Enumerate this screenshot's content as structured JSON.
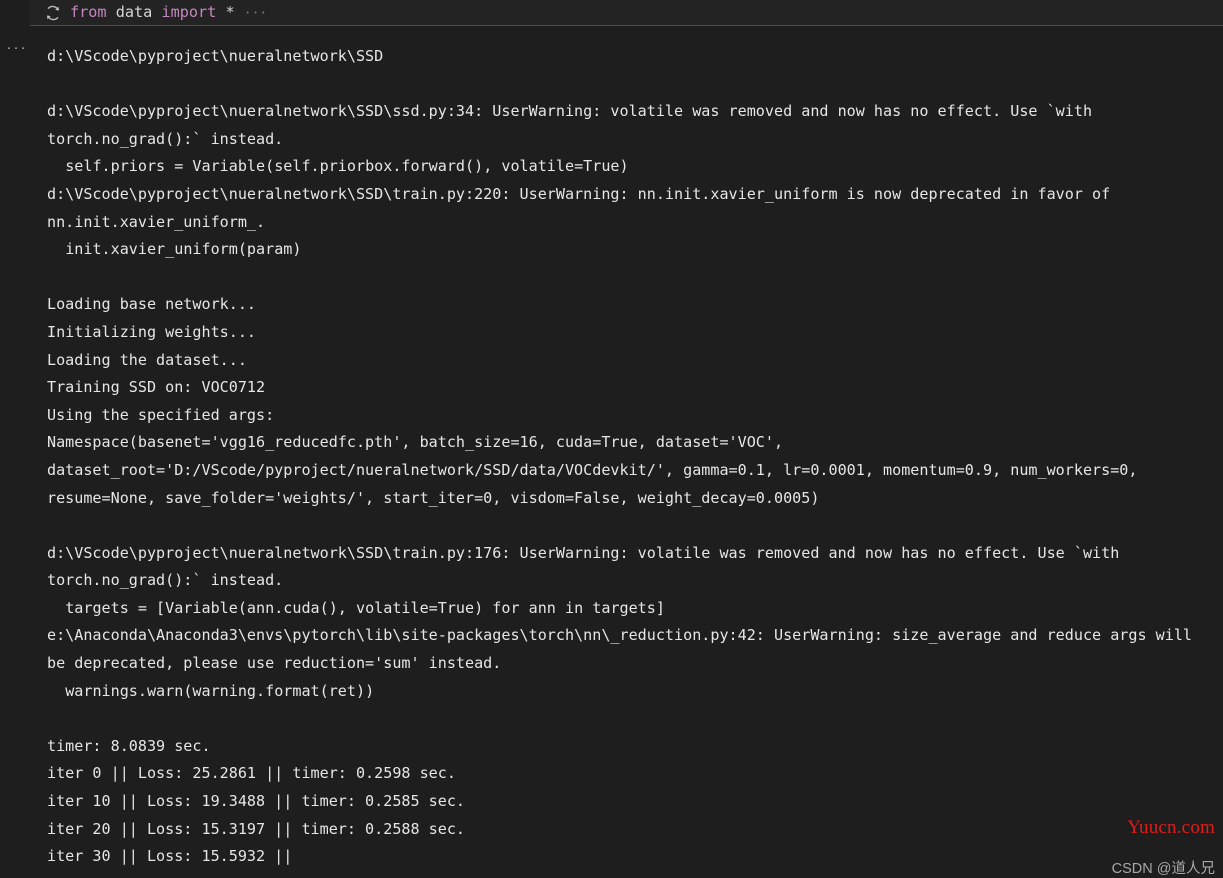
{
  "cell": {
    "run_icon": "restart-run-icon",
    "code": {
      "kw1": "from",
      "mod": " data ",
      "kw2": "import",
      "star": " *",
      "ellipsis": "···"
    }
  },
  "gutter": {
    "more_actions": "···"
  },
  "output": {
    "lines": [
      "d:\\VScode\\pyproject\\nueralnetwork\\SSD",
      "",
      "d:\\VScode\\pyproject\\nueralnetwork\\SSD\\ssd.py:34: UserWarning: volatile was removed and now has no effect. Use `with torch.no_grad():` instead.",
      "  self.priors = Variable(self.priorbox.forward(), volatile=True)",
      "d:\\VScode\\pyproject\\nueralnetwork\\SSD\\train.py:220: UserWarning: nn.init.xavier_uniform is now deprecated in favor of nn.init.xavier_uniform_.",
      "  init.xavier_uniform(param)",
      "",
      "Loading base network...",
      "Initializing weights...",
      "Loading the dataset...",
      "Training SSD on: VOC0712",
      "Using the specified args:",
      "Namespace(basenet='vgg16_reducedfc.pth', batch_size=16, cuda=True, dataset='VOC',",
      "dataset_root='D:/VScode/pyproject/nueralnetwork/SSD/data/VOCdevkit/', gamma=0.1, lr=0.0001, momentum=0.9, num_workers=0,",
      "resume=None, save_folder='weights/', start_iter=0, visdom=False, weight_decay=0.0005)",
      "",
      "d:\\VScode\\pyproject\\nueralnetwork\\SSD\\train.py:176: UserWarning: volatile was removed and now has no effect. Use `with torch.no_grad():` instead.",
      "  targets = [Variable(ann.cuda(), volatile=True) for ann in targets]",
      "e:\\Anaconda\\Anaconda3\\envs\\pytorch\\lib\\site-packages\\torch\\nn\\_reduction.py:42: UserWarning: size_average and reduce args will be deprecated, please use reduction='sum' instead.",
      "  warnings.warn(warning.format(ret))",
      "",
      "timer: 8.0839 sec.",
      "iter 0 || Loss: 25.2861 || timer: 0.2598 sec.",
      "iter 10 || Loss: 19.3488 || timer: 0.2585 sec.",
      "iter 20 || Loss: 15.3197 || timer: 0.2588 sec.",
      "iter 30 || Loss: 15.5932 ||"
    ],
    "training_log": [
      {
        "iter": "0",
        "loss": "25.2861",
        "timer": "0.2598"
      },
      {
        "iter": "10",
        "loss": "19.3488",
        "timer": "0.2585"
      },
      {
        "iter": "20",
        "loss": "15.3197",
        "timer": "0.2588"
      },
      {
        "iter": "30",
        "loss": "15.5932",
        "timer": ""
      }
    ],
    "initial_timer": "8.0839"
  },
  "watermarks": {
    "site": "Yuucn.com",
    "author": "CSDN @道人兄"
  },
  "colors": {
    "background": "#1e1e1e",
    "header_background": "#232323",
    "text": "#e6e6e6",
    "keyword": "#c586c0",
    "separator": "#4a4a4a",
    "watermark_red": "#e01b1b",
    "watermark_gray": "#a8a8a8"
  }
}
